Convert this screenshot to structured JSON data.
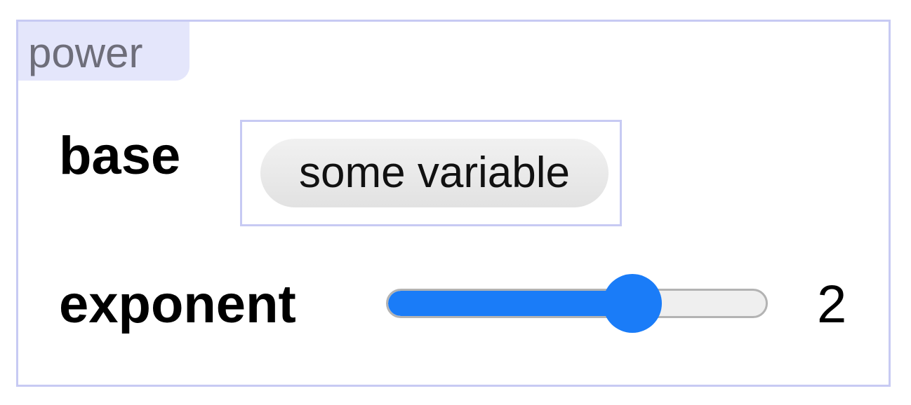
{
  "block": {
    "tag": "power"
  },
  "base": {
    "label": "base",
    "variable_chip": "some variable"
  },
  "exponent": {
    "label": "exponent",
    "value": "2",
    "slider_fraction": 0.645
  },
  "colors": {
    "accent": "#1a7cf8",
    "panel_border": "#c7caf3",
    "tag_background": "#e4e6fb"
  }
}
